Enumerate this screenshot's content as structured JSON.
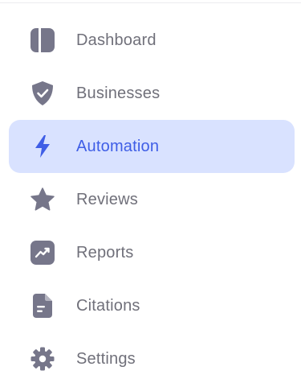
{
  "colors": {
    "icon_default": "#76768a",
    "text_default": "#70707a",
    "active_background": "#d9e2ff",
    "active_accent": "#3f5ee6"
  },
  "sidebar": {
    "items": [
      {
        "label": "Dashboard",
        "icon": "dashboard-icon",
        "active": false
      },
      {
        "label": "Businesses",
        "icon": "shield-check-icon",
        "active": false
      },
      {
        "label": "Automation",
        "icon": "lightning-icon",
        "active": true
      },
      {
        "label": "Reviews",
        "icon": "star-icon",
        "active": false
      },
      {
        "label": "Reports",
        "icon": "chart-trend-icon",
        "active": false
      },
      {
        "label": "Citations",
        "icon": "document-icon",
        "active": false
      },
      {
        "label": "Settings",
        "icon": "gear-icon",
        "active": false
      }
    ]
  }
}
